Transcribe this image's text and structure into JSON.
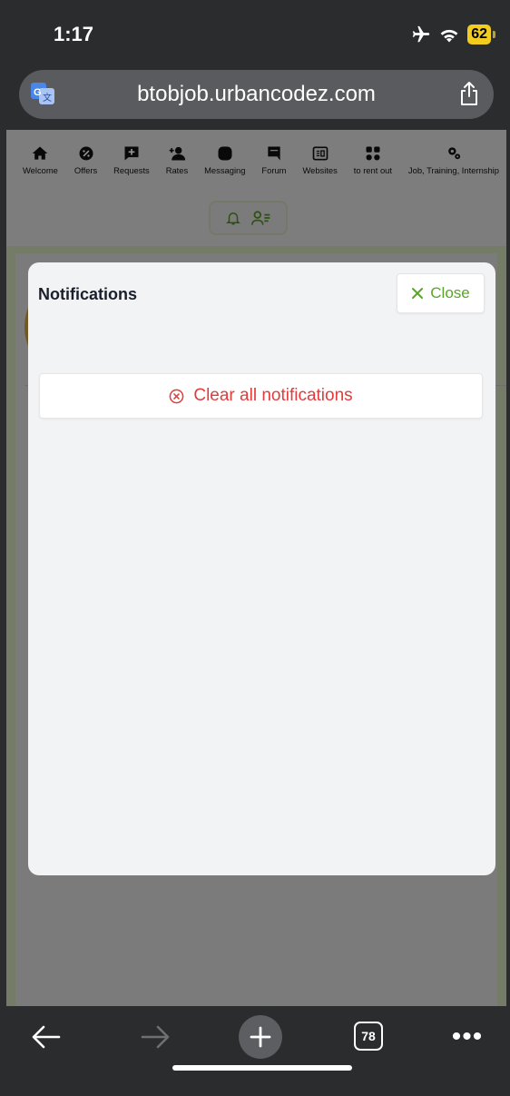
{
  "status_bar": {
    "time": "1:17",
    "battery": "62"
  },
  "browser": {
    "url": "btobjob.urbancodez.com",
    "tab_count": "78"
  },
  "nav": [
    {
      "label": "Welcome",
      "icon": "home-icon"
    },
    {
      "label": "Offers",
      "icon": "offers-icon"
    },
    {
      "label": "Requests",
      "icon": "requests-icon"
    },
    {
      "label": "Rates",
      "icon": "rates-icon"
    },
    {
      "label": "Messaging",
      "icon": "messaging-icon"
    },
    {
      "label": "Forum",
      "icon": "forum-icon"
    },
    {
      "label": "Websites",
      "icon": "websites-icon"
    },
    {
      "label": "to rent out",
      "icon": "grid-icon"
    },
    {
      "label": "Job, Training, Internship",
      "icon": "gears-icon"
    }
  ],
  "modal": {
    "title": "Notifications",
    "close_label": "Close",
    "clear_label": "Clear all notifications"
  },
  "colors": {
    "accent_green": "#5aa52a",
    "danger_red": "#e23b3b"
  }
}
